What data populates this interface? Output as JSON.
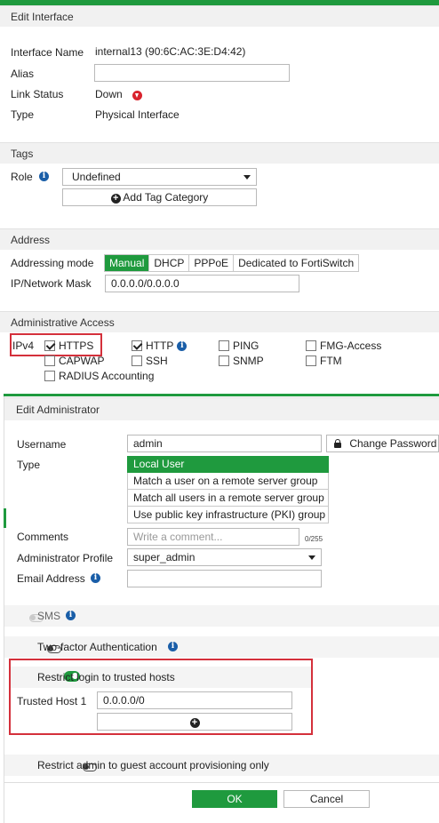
{
  "edit_interface": {
    "title": "Edit Interface",
    "interface_name_label": "Interface Name",
    "interface_name_value": "internal13 (90:6C:AC:3E:D4:42)",
    "alias_label": "Alias",
    "alias_value": "",
    "link_status_label": "Link Status",
    "link_status_value": "Down",
    "type_label": "Type",
    "type_value": "Physical Interface",
    "tags_title": "Tags",
    "role_label": "Role",
    "role_value": "Undefined",
    "add_tag_label": "Add Tag Category",
    "address_title": "Address",
    "addressing_mode_label": "Addressing mode",
    "addressing_modes": [
      "Manual",
      "DHCP",
      "PPPoE",
      "Dedicated to FortiSwitch"
    ],
    "addressing_mode_selected": "Manual",
    "ip_mask_label": "IP/Network Mask",
    "ip_mask_value": "0.0.0.0/0.0.0.0",
    "admin_access_title": "Administrative Access",
    "ipv4_label": "IPv4",
    "access": {
      "https": {
        "label": "HTTPS",
        "checked": true
      },
      "http": {
        "label": "HTTP",
        "checked": true
      },
      "ping": {
        "label": "PING",
        "checked": false
      },
      "fmg": {
        "label": "FMG-Access",
        "checked": false
      },
      "capwap": {
        "label": "CAPWAP",
        "checked": false
      },
      "ssh": {
        "label": "SSH",
        "checked": false
      },
      "snmp": {
        "label": "SNMP",
        "checked": false
      },
      "ftm": {
        "label": "FTM",
        "checked": false
      },
      "radius": {
        "label": "RADIUS Accounting",
        "checked": false
      }
    }
  },
  "edit_admin": {
    "title": "Edit Administrator",
    "username_label": "Username",
    "username_value": "admin",
    "change_password_label": "Change Password",
    "type_label": "Type",
    "type_options": [
      "Local User",
      "Match a user on a remote server group",
      "Match all users in a remote server group",
      "Use public key infrastructure (PKI) group"
    ],
    "comments_label": "Comments",
    "comments_placeholder": "Write a comment...",
    "comments_count": "0/255",
    "profile_label": "Administrator Profile",
    "profile_value": "super_admin",
    "email_label": "Email Address",
    "email_value": "",
    "sms_label": "SMS",
    "two_factor_label": "Two-factor Authentication",
    "restrict_login_label": "Restrict login to trusted hosts",
    "trusted_host_label": "Trusted Host 1",
    "trusted_host_value": "0.0.0.0/0",
    "restrict_guest_label": "Restrict admin to guest account provisioning only",
    "ok_label": "OK",
    "cancel_label": "Cancel"
  },
  "colors": {
    "accent": "#1f9a3e",
    "highlight_box": "#d4303b",
    "info_icon": "#1a5ea8",
    "status_down": "#d9232d"
  }
}
